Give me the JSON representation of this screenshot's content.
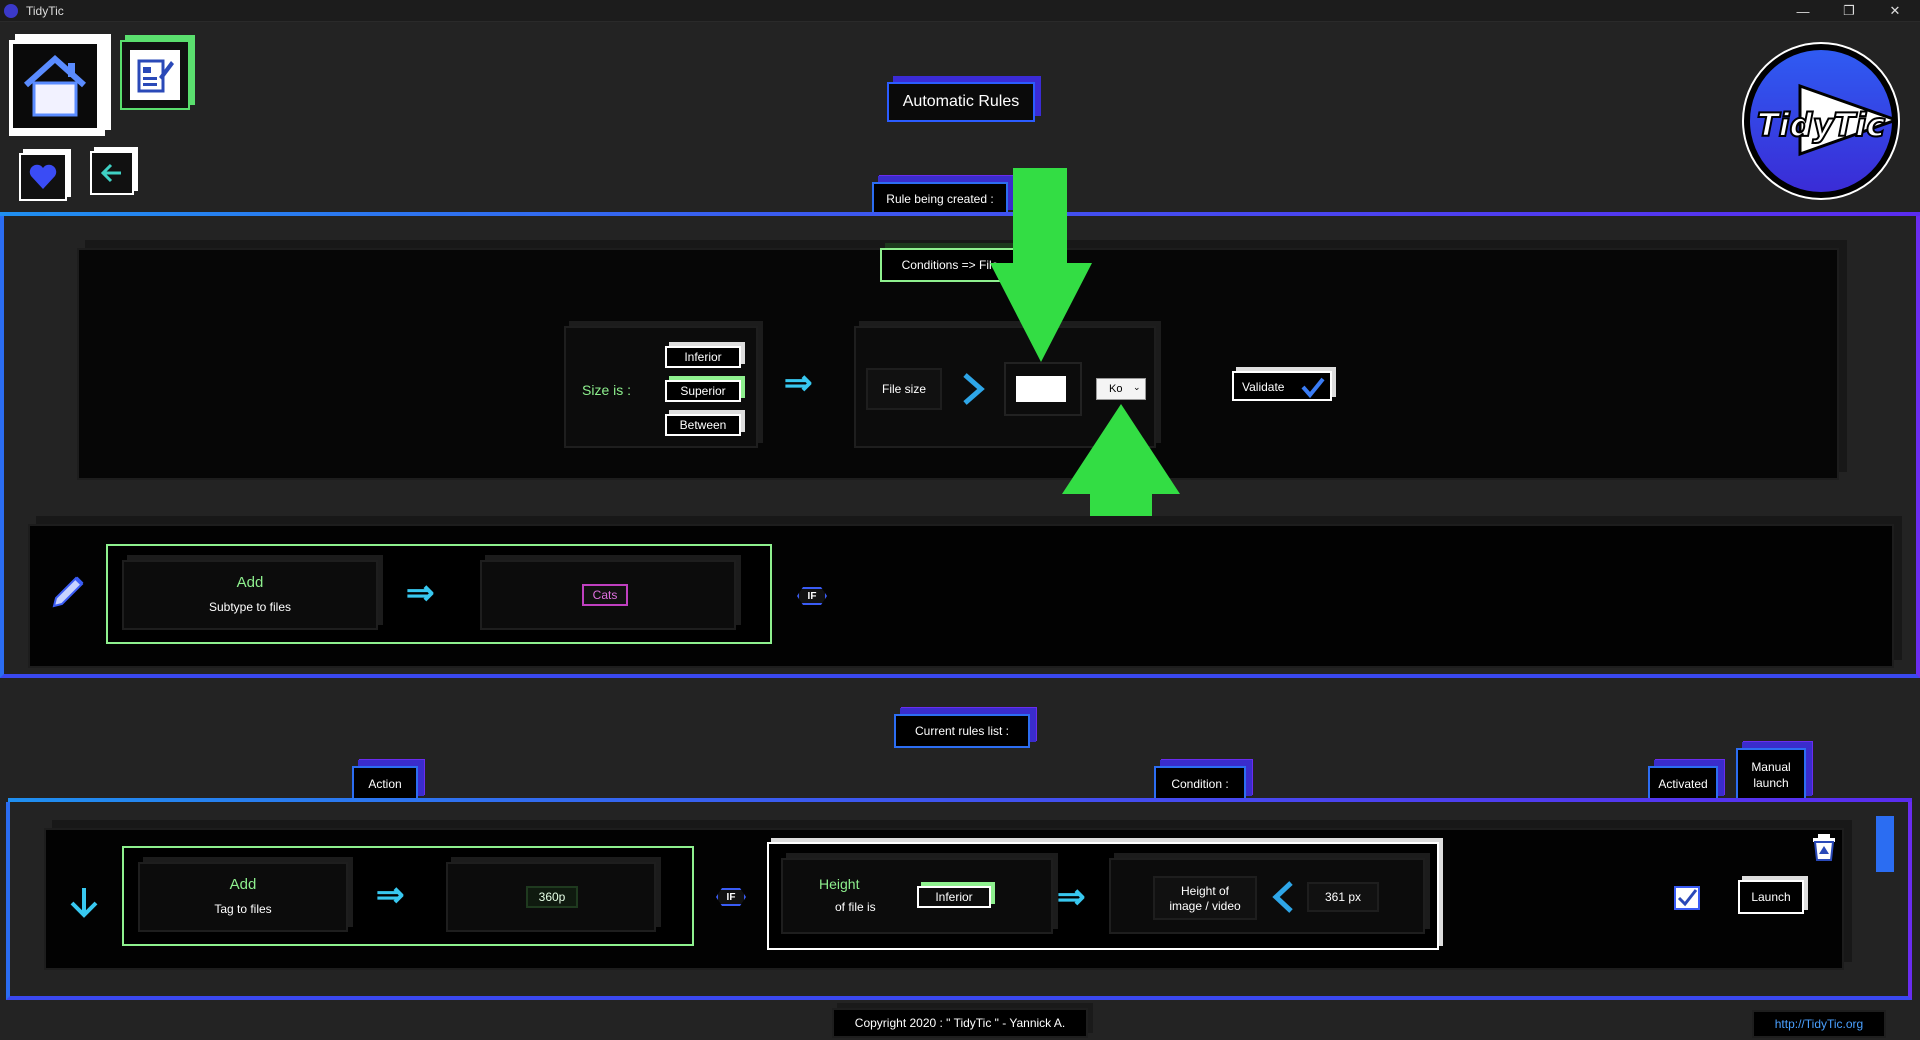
{
  "window": {
    "title": "TidyTic",
    "minimize_icon": "minimize-icon",
    "restore_icon": "restore-icon",
    "close_icon": "close-icon"
  },
  "nav": {
    "home_icon": "home-icon",
    "rules_icon": "rules-document-icon",
    "favorites_icon": "heart-icon",
    "back_icon": "back-arrow-icon"
  },
  "header": {
    "title": "Automatic Rules",
    "logo_text": "TidyTic"
  },
  "rule_creation": {
    "section_label": "Rule being created :",
    "conditions_label": "Conditions => File",
    "size_label": "Size is :",
    "options": [
      "Inferior",
      "Superior",
      "Between"
    ],
    "selected_option": "Superior",
    "file_size_label": "File size",
    "size_value": "",
    "unit_value": "Ko",
    "validate_label": "Validate",
    "action_verb": "Add",
    "action_object": "Subtype to files",
    "action_value": "Cats",
    "if_badge": "IF"
  },
  "rules_list": {
    "section_label": "Current rules list :",
    "column_action": "Action",
    "column_condition": "Condition :",
    "column_activated": "Activated",
    "column_manual_launch_line1": "Manual",
    "column_manual_launch_line2": "launch",
    "rules": [
      {
        "action_verb": "Add",
        "action_object": "Tag to files",
        "action_value": "360p",
        "if_badge": "IF",
        "condition_line1": "Height",
        "condition_line2": "of file is",
        "condition_operator": "Inferior",
        "condition_field_line1": "Height of",
        "condition_field_line2": "image / video",
        "condition_value": "361 px",
        "activated": true,
        "launch_label": "Launch"
      }
    ]
  },
  "footer": {
    "copyright": "Copyright 2020 : \" TidyTic \" - Yannick A.",
    "website": "http://TidyTic.org"
  },
  "colors": {
    "accent_blue": "#2b5cff",
    "accent_purple": "#5a2cf0",
    "accent_green": "#8ef08e",
    "highlight_green": "#33dd44",
    "cyan": "#38c8f0"
  }
}
